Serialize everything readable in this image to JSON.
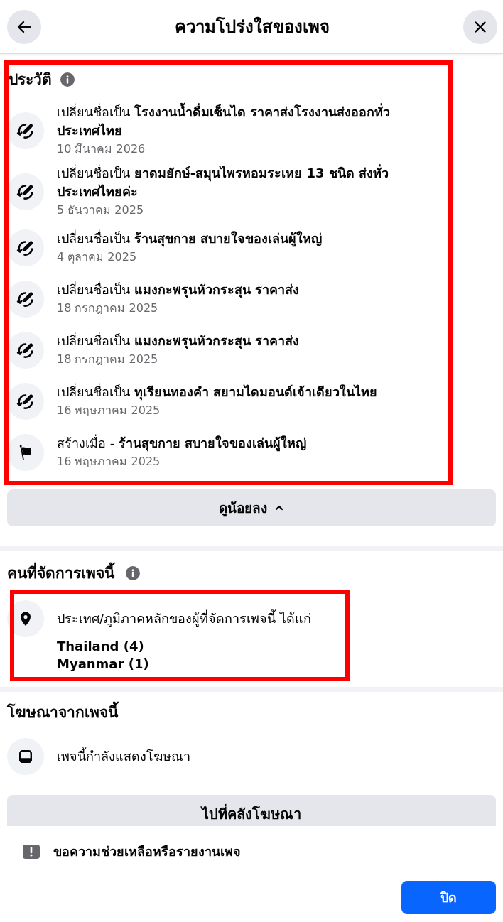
{
  "header": {
    "title": "ความโปร่งใสของเพจ"
  },
  "history": {
    "title": "ประวัติ",
    "highlighted": true,
    "items": [
      {
        "kind": "rename",
        "text": "เปลี่ยนชื่อเป็น **โรงงานน้ำดื่มเซ็นได ราคาส่งโรงงานส่งออกทั่วประเทศไทย**",
        "date": "10 มีนาคม 2026"
      },
      {
        "kind": "rename",
        "text": "เปลี่ยนชื่อเป็น **ยาดมยักษ์-สมุนไพรหอมระเหย 13 ชนิด ส่งทั่วประเทศไทยค่ะ**",
        "date": "5 ธันวาคม 2025"
      },
      {
        "kind": "rename",
        "text": "เปลี่ยนชื่อเป็น **ร้านสุขกาย สบายใจของเล่นผู้ใหญ่**",
        "date": "4 ตุลาคม 2025"
      },
      {
        "kind": "rename",
        "text": "เปลี่ยนชื่อเป็น **แมงกะพรุนหัวกระสุน ราคาส่ง**",
        "date": "18 กรกฎาคม 2025"
      },
      {
        "kind": "rename",
        "text": "เปลี่ยนชื่อเป็น **แมงกะพรุนหัวกระสุน ราคาส่ง**",
        "date": "18 กรกฎาคม 2025"
      },
      {
        "kind": "rename",
        "text": "เปลี่ยนชื่อเป็น **ทุเรียนทองคำ สยามไดมอนด์เจ้าเดียวในไทย**",
        "date": "16 พฤษภาคม 2025"
      },
      {
        "kind": "created",
        "text": "สร้างเมื่อ - **ร้านสุขกาย สบายใจของเล่นผู้ใหญ่**",
        "date": "16 พฤษภาคม 2025"
      }
    ],
    "toggle_button": {
      "label": "ดูน้อยลง",
      "expanded": true
    }
  },
  "managers": {
    "title": "คนที่จัดการเพจนี้",
    "highlighted": true,
    "location_text": "ประเทศ/ภูมิภาคหลักของผู้ที่จัดการเพจนี้ ได้แก่",
    "countries": [
      "Thailand (4)",
      "Myanmar (1)"
    ]
  },
  "ads": {
    "title": "โฆษณาจากเพจนี้",
    "status": "เพจนี้กำลังแสดงโฆษณา",
    "library_button": "ไปที่คลังโฆษณา"
  },
  "footer": {
    "report_link": "ขอความช่วยเหลือหรือรายงานเพจ",
    "close_button": "ปิด"
  }
}
